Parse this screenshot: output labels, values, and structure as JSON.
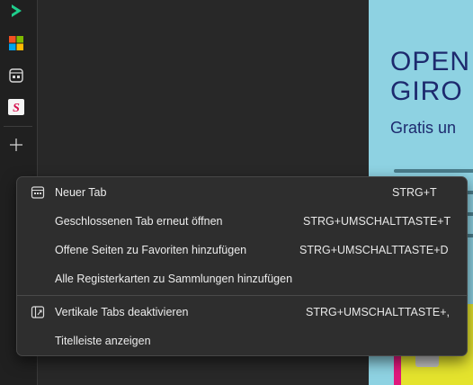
{
  "strip": {
    "icons": [
      "play-icon",
      "microsoft-logo-icon",
      "collections-icon",
      "s-logo-icon",
      "add-icon"
    ]
  },
  "web": {
    "headline_line1": "OPEN",
    "headline_line2": "GIRO",
    "subline": "Gratis un",
    "colors": {
      "background": "#8ed2e2",
      "text": "#1d2a6e",
      "card": "#e4e32d",
      "accent": "#e0177c"
    }
  },
  "menu": {
    "items": [
      {
        "label": "Neuer Tab",
        "shortcut": "STRG+T",
        "icon": "new-tab-icon"
      },
      {
        "label": "Geschlossenen Tab erneut öffnen",
        "shortcut": "STRG+UMSCHALTTASTE+T",
        "icon": ""
      },
      {
        "label": "Offene Seiten zu Favoriten hinzufügen",
        "shortcut": "STRG+UMSCHALTTASTE+D",
        "icon": ""
      },
      {
        "label": "Alle Registerkarten zu Sammlungen hinzufügen",
        "shortcut": "",
        "icon": ""
      },
      {
        "label": "Vertikale Tabs deaktivieren",
        "shortcut": "STRG+UMSCHALTTASTE+,",
        "icon": "vertical-tabs-icon"
      },
      {
        "label": "Titelleiste anzeigen",
        "shortcut": "",
        "icon": ""
      }
    ]
  }
}
